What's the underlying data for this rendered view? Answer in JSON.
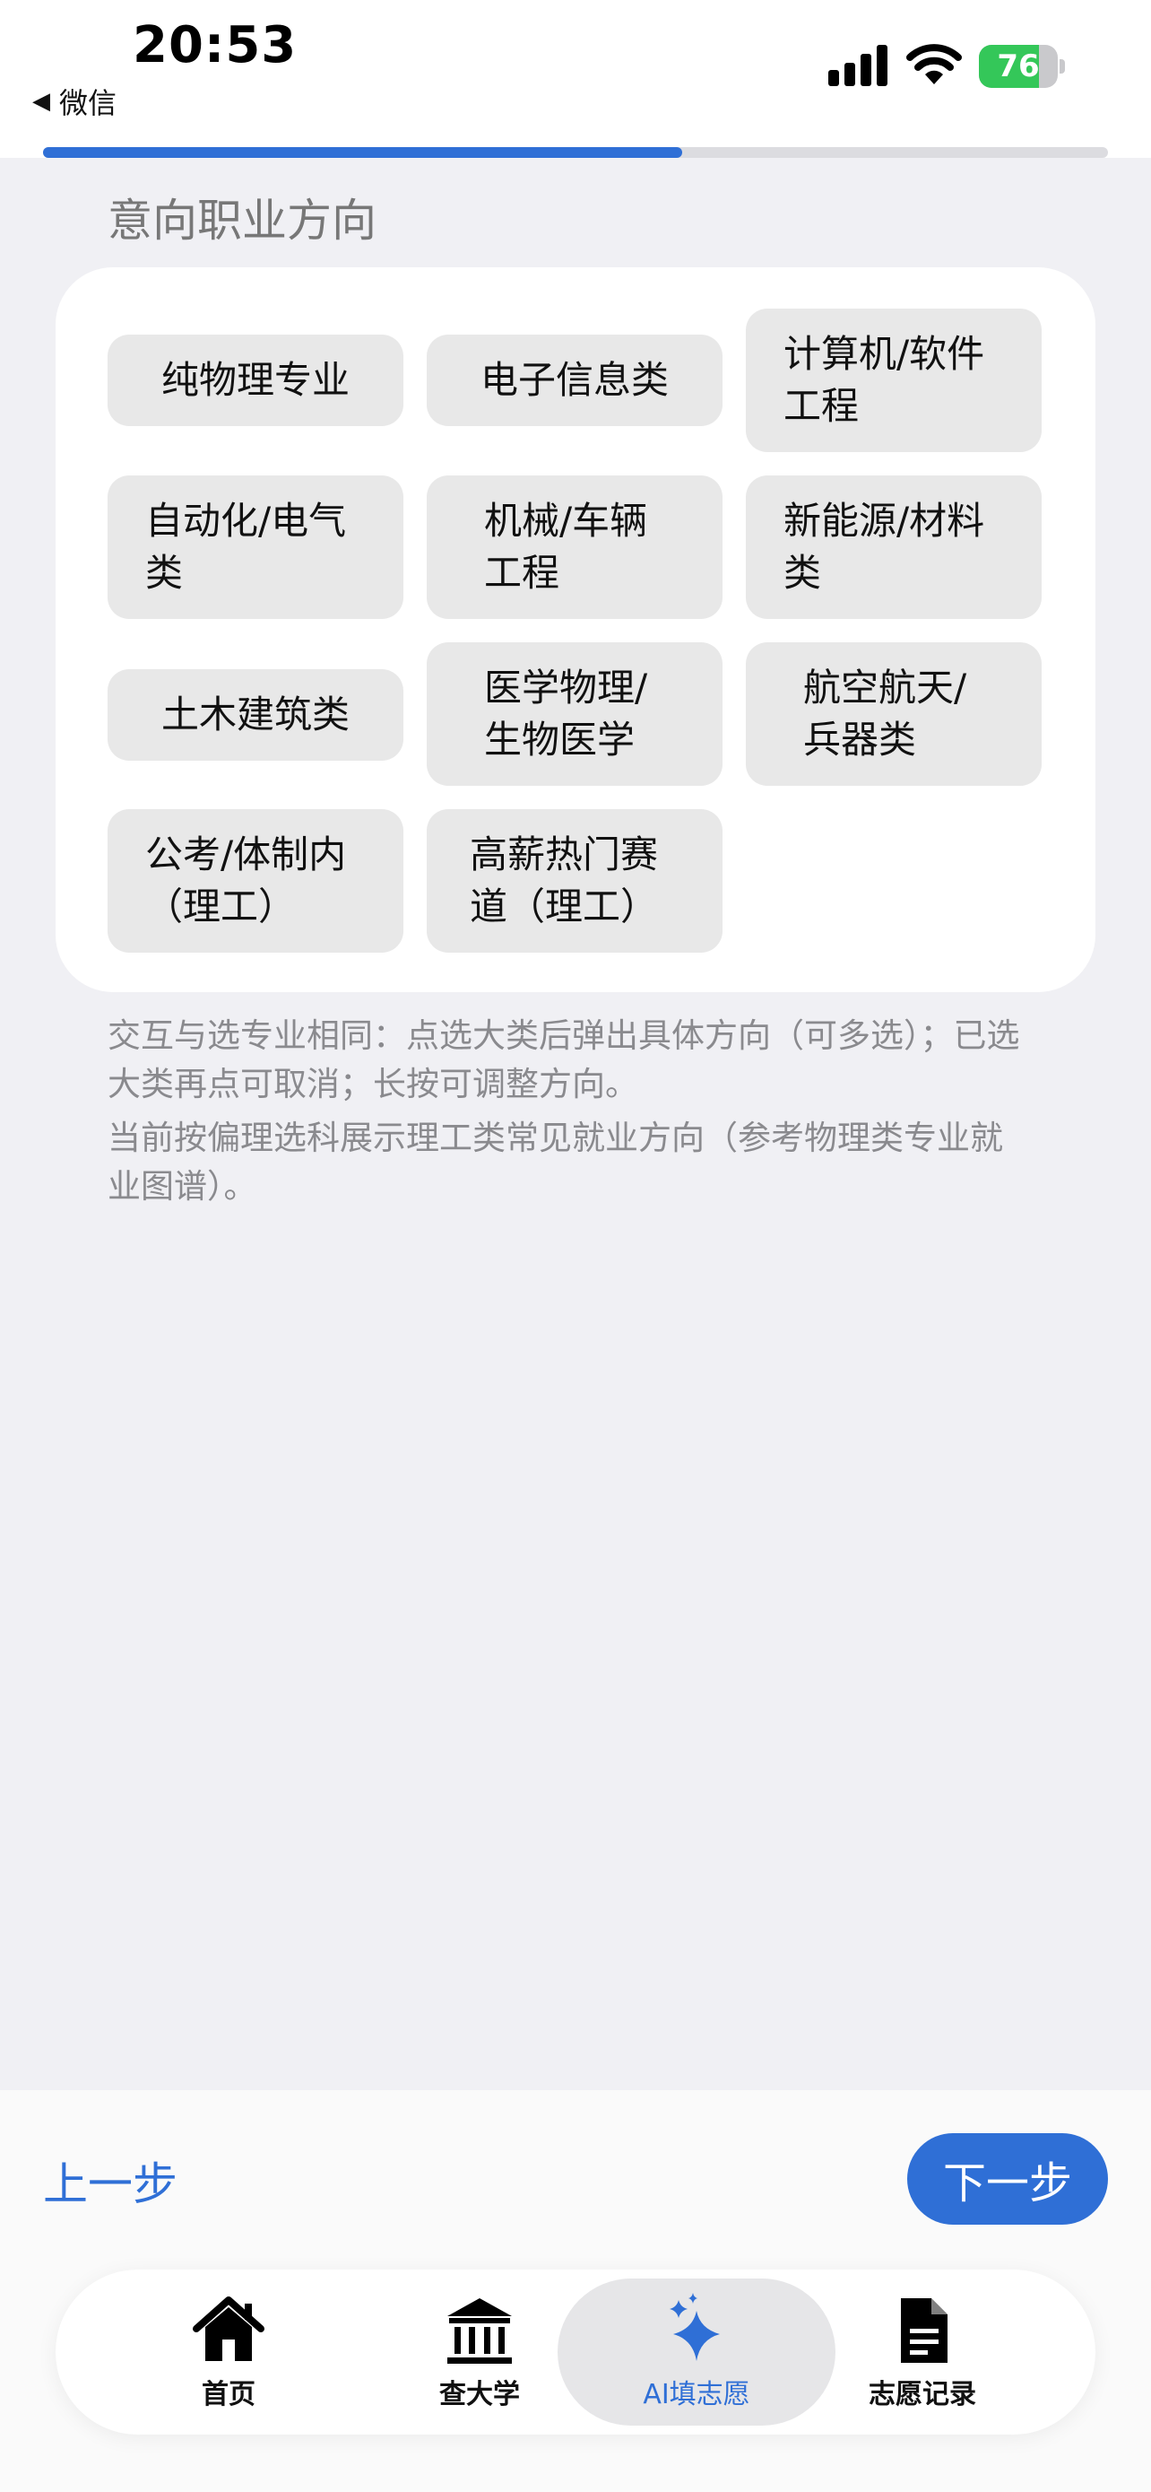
{
  "status_bar": {
    "time": "20:53",
    "back_label": "微信",
    "battery_level": "76",
    "battery_fraction": 0.76
  },
  "progress": {
    "fraction": 0.6
  },
  "section": {
    "title": "意向职业方向"
  },
  "options": [
    {
      "label": "纯物理专业"
    },
    {
      "label": "电子信息类"
    },
    {
      "label": "计算机/软件工程"
    },
    {
      "label": "自动化/电气类"
    },
    {
      "label": "机械/车辆工程"
    },
    {
      "label": "新能源/材料类"
    },
    {
      "label": "土木建筑类"
    },
    {
      "label": "医学物理/生物医学"
    },
    {
      "label": "航空航天/兵器类"
    },
    {
      "label": "公考/体制内（理工）"
    },
    {
      "label": "高薪热门赛道（理工）"
    }
  ],
  "hints": {
    "interaction": "交互与选专业相同：点选大类后弹出具体方向（可多选）；已选大类再点可取消；长按可调整方向。",
    "scope": "当前按偏理选科展示理工类常见就业方向（参考物理类专业就业图谱）。"
  },
  "nav": {
    "prev_label": "上一步",
    "next_label": "下一步"
  },
  "tabbar": {
    "tabs": [
      {
        "label": "首页",
        "icon": "home-icon"
      },
      {
        "label": "查大学",
        "icon": "university-icon"
      },
      {
        "label": "AI填志愿",
        "icon": "sparkles-icon"
      },
      {
        "label": "志愿记录",
        "icon": "document-icon"
      }
    ],
    "active_index": 2
  },
  "colors": {
    "accent": "#2f6fd6",
    "chip_bg": "#e8e8e8",
    "page_bg": "#f0f0f4",
    "battery_green": "#34c759"
  }
}
